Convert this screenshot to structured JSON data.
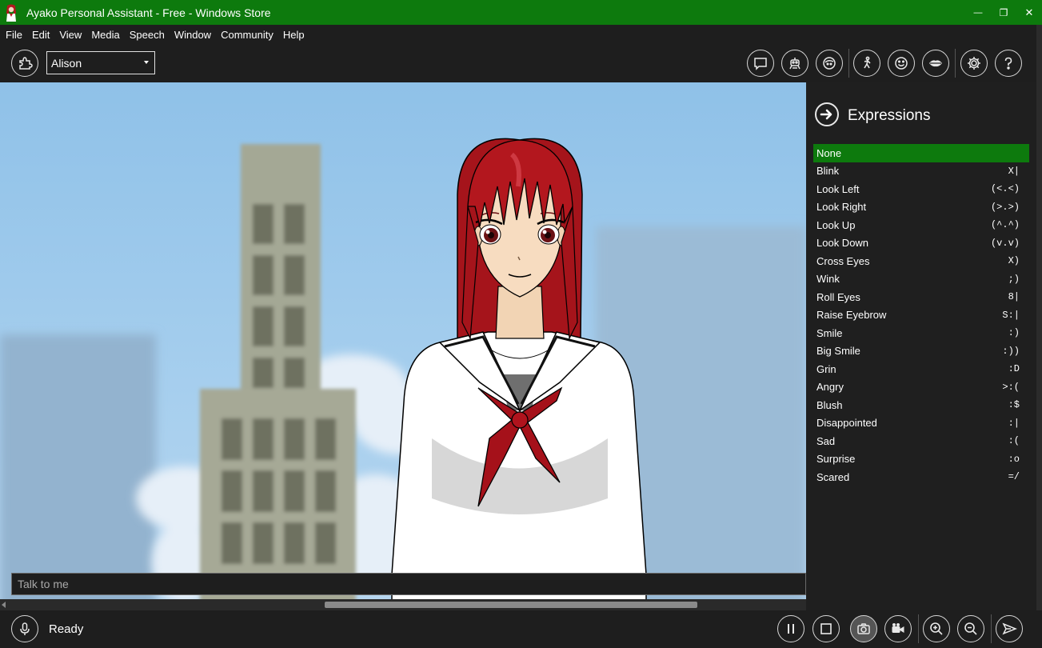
{
  "window": {
    "title": "Ayako Personal Assistant - Free - Windows Store",
    "minimize_glyph": "—",
    "restore_glyph": "❐",
    "close_glyph": "✕"
  },
  "menu": [
    "File",
    "Edit",
    "View",
    "Media",
    "Speech",
    "Window",
    "Community",
    "Help"
  ],
  "toolbar": {
    "character_selected": "Alison",
    "left_icon": "puzzle-icon",
    "right_icons": [
      "chat-bubble-icon",
      "robot-icon",
      "face-profile-icon",
      "walking-figure-icon",
      "smiley-icon",
      "lips-icon",
      "gear-icon",
      "help-icon"
    ]
  },
  "expressions_panel": {
    "title": "Expressions",
    "back_icon": "arrow-right-icon",
    "items": [
      {
        "label": "None",
        "shortcut": "",
        "selected": true
      },
      {
        "label": "Blink",
        "shortcut": "X|"
      },
      {
        "label": "Look Left",
        "shortcut": "(<.<)"
      },
      {
        "label": "Look Right",
        "shortcut": "(>.>)"
      },
      {
        "label": "Look Up",
        "shortcut": "(^.^)"
      },
      {
        "label": "Look Down",
        "shortcut": "(v.v)"
      },
      {
        "label": "Cross Eyes",
        "shortcut": "X)"
      },
      {
        "label": "Wink",
        "shortcut": ";)"
      },
      {
        "label": "Roll Eyes",
        "shortcut": "8|"
      },
      {
        "label": "Raise Eyebrow",
        "shortcut": "S:|"
      },
      {
        "label": "Smile",
        "shortcut": ":)"
      },
      {
        "label": "Big Smile",
        "shortcut": ":))"
      },
      {
        "label": "Grin",
        "shortcut": ":D"
      },
      {
        "label": "Angry",
        "shortcut": ">:("
      },
      {
        "label": "Blush",
        "shortcut": ":$"
      },
      {
        "label": "Disappointed",
        "shortcut": ":|"
      },
      {
        "label": "Sad",
        "shortcut": ":("
      },
      {
        "label": "Surprise",
        "shortcut": ":o"
      },
      {
        "label": "Scared",
        "shortcut": "=/"
      }
    ]
  },
  "chat": {
    "placeholder": "Talk to me"
  },
  "status": {
    "text": "Ready",
    "mic_icon": "microphone-icon"
  },
  "bottom_controls": [
    "pause-icon",
    "stop-icon",
    "camera-icon",
    "video-camera-icon",
    "zoom-in-icon",
    "zoom-out-icon",
    "send-icon"
  ],
  "colors": {
    "accent": "#0d7a0d",
    "background": "#1e1e1e",
    "sky": "#8fc1e8",
    "hair": "#b3171e"
  }
}
